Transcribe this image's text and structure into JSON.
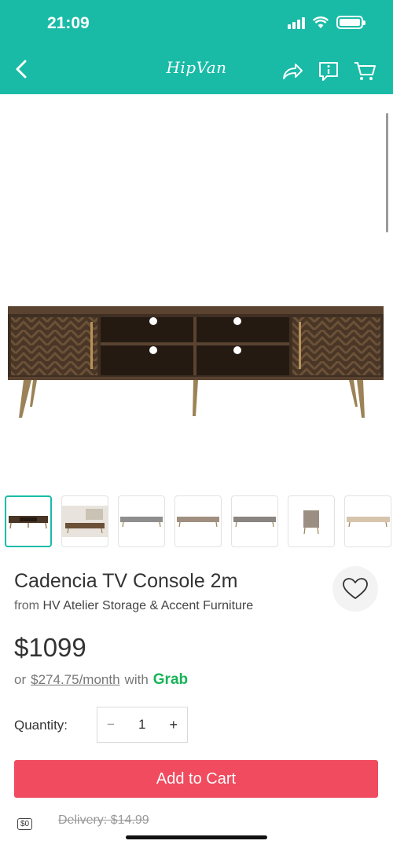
{
  "status_bar": {
    "time": "21:09"
  },
  "nav": {
    "logo": "HipVan"
  },
  "product": {
    "title": "Cadencia TV Console 2m",
    "from_prefix": "from",
    "brand": "HV Atelier Storage & Accent Furniture",
    "price": "$1099",
    "installment": {
      "prefix": "or",
      "monthly": "$274.75/month",
      "with": "with",
      "provider": "Grab"
    },
    "thumbnail_count": 7,
    "active_thumbnail": 1
  },
  "quantity": {
    "label": "Quantity:",
    "minus": "−",
    "value": "1",
    "plus": "+"
  },
  "cart": {
    "button_label": "Add to Cart"
  },
  "delivery": {
    "badge": "$0",
    "old_price": "Delivery: $14.99"
  },
  "icons": [
    "back-icon",
    "share-icon",
    "info-icon",
    "cart-icon",
    "heart-icon",
    "delivery-truck-icon"
  ],
  "colors": {
    "brand_teal": "#19bba7",
    "cta_red": "#f04b5e",
    "grab_green": "#17b356"
  }
}
